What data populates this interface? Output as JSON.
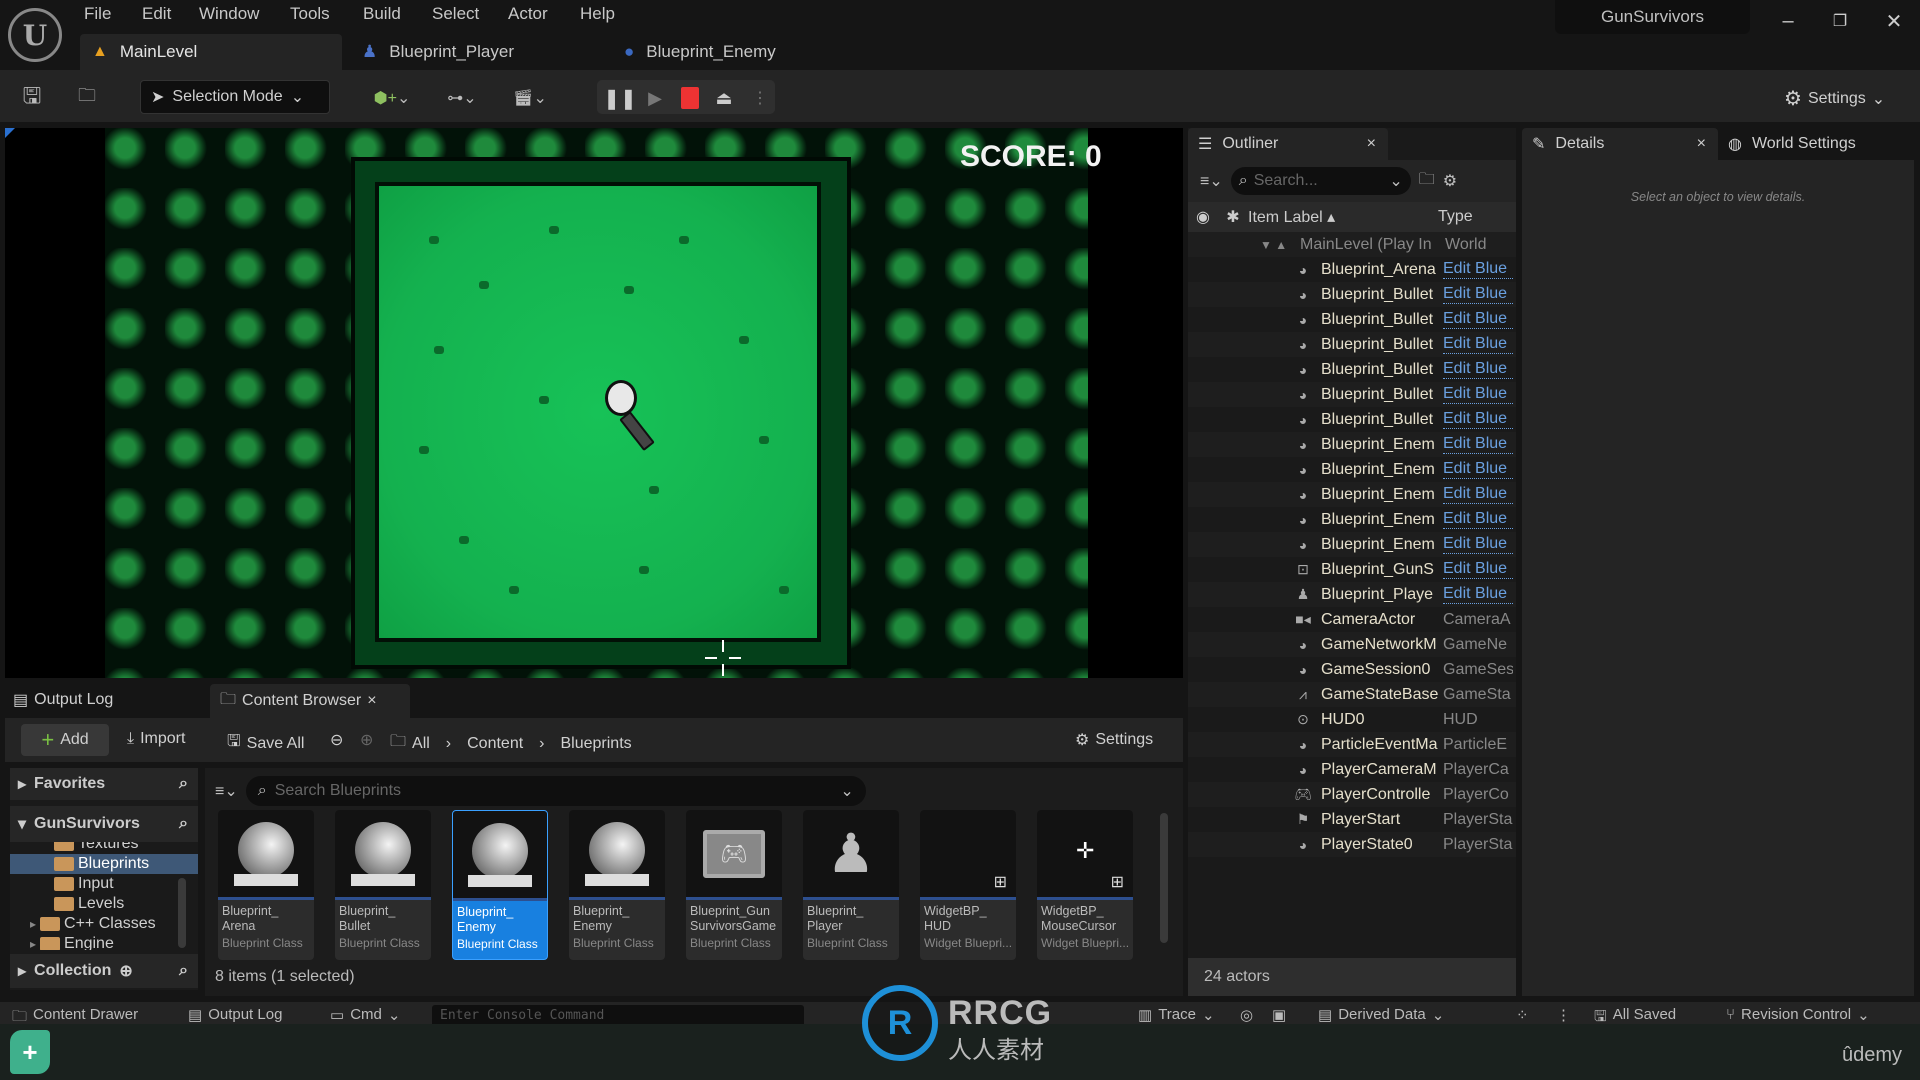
{
  "app": {
    "project_name": "GunSurvivors",
    "menu": [
      "File",
      "Edit",
      "Window",
      "Tools",
      "Build",
      "Select",
      "Actor",
      "Help"
    ],
    "doc_tabs": [
      {
        "label": "MainLevel",
        "icon": "level-icon",
        "active": true
      },
      {
        "label": "Blueprint_Player",
        "icon": "pawn-icon",
        "active": false
      },
      {
        "label": "Blueprint_Enemy",
        "icon": "actor-icon",
        "active": false
      }
    ],
    "window_controls": {
      "minimize": "–",
      "restore": "❐",
      "close": "✕"
    }
  },
  "toolbar": {
    "selection_mode": "Selection Mode",
    "settings": "Settings",
    "play_state": "playing"
  },
  "viewport": {
    "score_text": "SCORE: 0"
  },
  "outliner": {
    "tab_label": "Outliner",
    "search_placeholder": "Search...",
    "col_label": "Item Label",
    "col_type": "Type",
    "root": {
      "label": "MainLevel (Play In",
      "type": "World"
    },
    "items": [
      {
        "label": "Blueprint_Arena",
        "type": "Edit Blue",
        "link": true,
        "icon": "actor-icon"
      },
      {
        "label": "Blueprint_Bullet",
        "type": "Edit Blue",
        "link": true,
        "icon": "actor-icon"
      },
      {
        "label": "Blueprint_Bullet",
        "type": "Edit Blue",
        "link": true,
        "icon": "actor-icon"
      },
      {
        "label": "Blueprint_Bullet",
        "type": "Edit Blue",
        "link": true,
        "icon": "actor-icon"
      },
      {
        "label": "Blueprint_Bullet",
        "type": "Edit Blue",
        "link": true,
        "icon": "actor-icon"
      },
      {
        "label": "Blueprint_Bullet",
        "type": "Edit Blue",
        "link": true,
        "icon": "actor-icon"
      },
      {
        "label": "Blueprint_Bullet",
        "type": "Edit Blue",
        "link": true,
        "icon": "actor-icon"
      },
      {
        "label": "Blueprint_Enem",
        "type": "Edit Blue",
        "link": true,
        "icon": "actor-icon"
      },
      {
        "label": "Blueprint_Enem",
        "type": "Edit Blue",
        "link": true,
        "icon": "actor-icon"
      },
      {
        "label": "Blueprint_Enem",
        "type": "Edit Blue",
        "link": true,
        "icon": "actor-icon"
      },
      {
        "label": "Blueprint_Enem",
        "type": "Edit Blue",
        "link": true,
        "icon": "actor-icon"
      },
      {
        "label": "Blueprint_Enem",
        "type": "Edit Blue",
        "link": true,
        "icon": "actor-icon"
      },
      {
        "label": "Blueprint_GunS",
        "type": "Edit Blue",
        "link": true,
        "icon": "gamemode-icon"
      },
      {
        "label": "Blueprint_Playe",
        "type": "Edit Blue",
        "link": true,
        "icon": "pawn-icon"
      },
      {
        "label": "CameraActor",
        "type": "CameraA",
        "link": false,
        "icon": "camera-icon"
      },
      {
        "label": "GameNetworkM",
        "type": "GameNe",
        "link": false,
        "icon": "actor-icon"
      },
      {
        "label": "GameSession0",
        "type": "GameSes",
        "link": false,
        "icon": "actor-icon"
      },
      {
        "label": "GameStateBase",
        "type": "GameSta",
        "link": false,
        "icon": "chart-icon"
      },
      {
        "label": "HUD0",
        "type": "HUD",
        "link": false,
        "icon": "hud-icon"
      },
      {
        "label": "ParticleEventMa",
        "type": "ParticleE",
        "link": false,
        "icon": "actor-icon"
      },
      {
        "label": "PlayerCameraM",
        "type": "PlayerCa",
        "link": false,
        "icon": "actor-icon"
      },
      {
        "label": "PlayerControlle",
        "type": "PlayerCo",
        "link": false,
        "icon": "gamepad-icon"
      },
      {
        "label": "PlayerStart",
        "type": "PlayerSta",
        "link": false,
        "icon": "flag-icon"
      },
      {
        "label": "PlayerState0",
        "type": "PlayerSta",
        "link": false,
        "icon": "actor-icon"
      }
    ],
    "actor_count": "24 actors"
  },
  "details": {
    "tab_label": "Details",
    "world_settings_label": "World Settings",
    "empty_text": "Select an object to view details."
  },
  "bottom_tabs": {
    "output_log": "Output Log",
    "content_browser": "Content Browser"
  },
  "content_browser": {
    "add": "Add",
    "import": "Import",
    "save_all": "Save All",
    "breadcrumb": [
      "All",
      "Content",
      "Blueprints"
    ],
    "settings": "Settings",
    "search_placeholder": "Search Blueprints",
    "favorites": "Favorites",
    "project": "GunSurvivors",
    "tree": [
      {
        "label": "Textures",
        "indent": 2,
        "expander": false
      },
      {
        "label": "Blueprints",
        "indent": 2,
        "expander": false,
        "selected": true
      },
      {
        "label": "Input",
        "indent": 2,
        "expander": false
      },
      {
        "label": "Levels",
        "indent": 2,
        "expander": false
      },
      {
        "label": "C++ Classes",
        "indent": 1,
        "expander": true
      },
      {
        "label": "Engine",
        "indent": 1,
        "expander": true
      }
    ],
    "collection": "Collection",
    "assets": [
      {
        "name": "Blueprint_ Arena",
        "class": "Blueprint Class",
        "thumb": "sphere",
        "selected": false
      },
      {
        "name": "Blueprint_ Bullet",
        "class": "Blueprint Class",
        "thumb": "sphere",
        "selected": false
      },
      {
        "name": "Blueprint_ Enemy",
        "class": "Blueprint Class",
        "thumb": "sphere",
        "selected": true
      },
      {
        "name": "Blueprint_ Enemy",
        "class": "Blueprint Class",
        "thumb": "sphere",
        "selected": false
      },
      {
        "name": "Blueprint_Gun SurvivorsGame",
        "class": "Blueprint Class",
        "thumb": "gamemode",
        "selected": false
      },
      {
        "name": "Blueprint_ Player",
        "class": "Blueprint Class",
        "thumb": "pawn",
        "selected": false
      },
      {
        "name": "WidgetBP_ HUD",
        "class": "Widget Bluepri...",
        "thumb": "widget",
        "selected": false
      },
      {
        "name": "WidgetBP_ MouseCursor",
        "class": "Widget Bluepri...",
        "thumb": "widget-cursor",
        "selected": false
      }
    ],
    "item_count": "8 items (1 selected)"
  },
  "statusbar": {
    "content_drawer": "Content Drawer",
    "output_log": "Output Log",
    "cmd": "Cmd",
    "console_placeholder": "Enter Console Command",
    "trace": "Trace",
    "derived_data": "Derived Data",
    "all_saved": "All Saved",
    "revision_control": "Revision Control"
  },
  "watermark": {
    "brand": "RRCG",
    "sub": "人人素材",
    "udemy": "ûdemy"
  }
}
